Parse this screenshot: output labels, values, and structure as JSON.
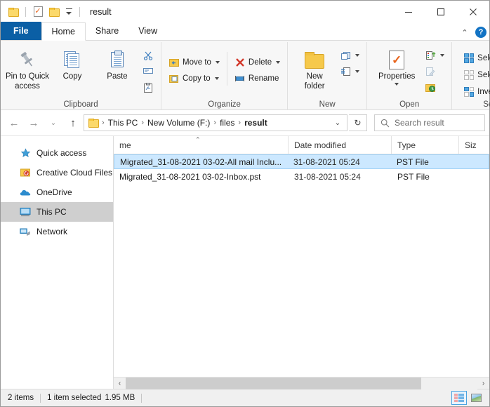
{
  "window": {
    "title": "result",
    "quick_access_toolbar": [
      {
        "name": "properties-folder-icon",
        "label": "Properties"
      },
      {
        "name": "new-folder-icon",
        "label": "New folder"
      },
      {
        "name": "customize-qat-caret",
        "label": "Customize Quick Access Toolbar"
      }
    ],
    "controls": {
      "minimize": "Minimize",
      "maximize": "Maximize",
      "close": "Close"
    }
  },
  "tabs": [
    {
      "label": "File",
      "type": "file"
    },
    {
      "label": "Home",
      "type": "active"
    },
    {
      "label": "Share",
      "type": "normal"
    },
    {
      "label": "View",
      "type": "normal"
    }
  ],
  "tab_right": {
    "collapse": "⌃",
    "help": "?"
  },
  "ribbon": {
    "groups": [
      {
        "label": "Clipboard",
        "big": [
          {
            "label_line1": "Pin to Quick",
            "label_line2": "access",
            "icon": "pin-icon"
          },
          {
            "label_line1": "Copy",
            "label_line2": "",
            "icon": "copy-icon"
          },
          {
            "label_line1": "Paste",
            "label_line2": "",
            "icon": "paste-icon"
          }
        ],
        "small": [
          {
            "label": "",
            "icon": "cut-icon"
          },
          {
            "label": "",
            "icon": "copy-path-icon"
          },
          {
            "label": "",
            "icon": "paste-shortcut-icon"
          }
        ]
      },
      {
        "label": "Organize",
        "small_left": [
          {
            "label": "Move to",
            "icon": "move-to-icon",
            "caret": true
          },
          {
            "label": "Copy to",
            "icon": "copy-to-icon",
            "caret": true
          }
        ],
        "small_right": [
          {
            "label": "Delete",
            "icon": "delete-icon",
            "caret": true
          },
          {
            "label": "Rename",
            "icon": "rename-icon",
            "caret": false
          }
        ]
      },
      {
        "label": "New",
        "big": [
          {
            "label_line1": "New",
            "label_line2": "folder",
            "icon": "new-folder-icon"
          }
        ],
        "small": [
          {
            "label": "",
            "icon": "new-item-icon",
            "caret": true
          },
          {
            "label": "",
            "icon": "easy-access-icon",
            "caret": true
          }
        ]
      },
      {
        "label": "Open",
        "big": [
          {
            "label_line1": "Properties",
            "label_line2": "",
            "icon": "properties-icon",
            "caret": true
          }
        ],
        "small": [
          {
            "label": "",
            "icon": "open-icon",
            "caret": true
          },
          {
            "label": "",
            "icon": "edit-icon",
            "caret": false
          },
          {
            "label": "",
            "icon": "history-icon",
            "caret": false
          }
        ]
      },
      {
        "label": "Select",
        "items": [
          {
            "label": "Select all",
            "icon": "select-all-icon"
          },
          {
            "label": "Select none",
            "icon": "select-none-icon"
          },
          {
            "label": "Invert selection",
            "icon": "invert-selection-icon"
          }
        ]
      }
    ]
  },
  "addressbar": {
    "back": "←",
    "forward": "→",
    "history": "⌄",
    "up": "↑",
    "breadcrumbs": [
      "This PC",
      "New Volume (F:)",
      "files",
      "result"
    ],
    "separator": "›",
    "dropdown": "⌄",
    "refresh": "↻",
    "search_placeholder": "Search result"
  },
  "sidebar": {
    "items": [
      {
        "label": "Quick access",
        "icon": "star-icon",
        "selected": false
      },
      {
        "label": "Creative Cloud Files",
        "icon": "creative-cloud-icon",
        "selected": false
      },
      {
        "label": "OneDrive",
        "icon": "cloud-icon",
        "selected": false
      },
      {
        "label": "This PC",
        "icon": "monitor-icon",
        "selected": true
      },
      {
        "label": "Network",
        "icon": "network-icon",
        "selected": false
      }
    ]
  },
  "filelist": {
    "columns": [
      {
        "label": "me",
        "key": "name"
      },
      {
        "label": "Date modified",
        "key": "date"
      },
      {
        "label": "Type",
        "key": "type"
      },
      {
        "label": "Siz",
        "key": "size"
      }
    ],
    "sort_indicator": "⌃",
    "rows": [
      {
        "name": "Migrated_31-08-2021 03-02-All mail Inclu...",
        "date": "31-08-2021 05:24",
        "type": "PST File",
        "size": "",
        "selected": true
      },
      {
        "name": "Migrated_31-08-2021 03-02-Inbox.pst",
        "date": "31-08-2021 05:24",
        "type": "PST File",
        "size": "",
        "selected": false
      }
    ],
    "scroll_left_arrow": "‹",
    "scroll_right_arrow": "›"
  },
  "statusbar": {
    "item_count": "2 items",
    "selection_info": "1 item selected",
    "selection_size": "1.95 MB",
    "views": [
      {
        "name": "details-view-button",
        "label": "Details",
        "active": true
      },
      {
        "name": "large-icons-view-button",
        "label": "Large icons",
        "active": false
      }
    ]
  },
  "colors": {
    "file_tab": "#0b5fa5",
    "selection": "#cce8ff",
    "sidebar_selection": "#cfcfcf",
    "help_icon": "#1273c4"
  }
}
